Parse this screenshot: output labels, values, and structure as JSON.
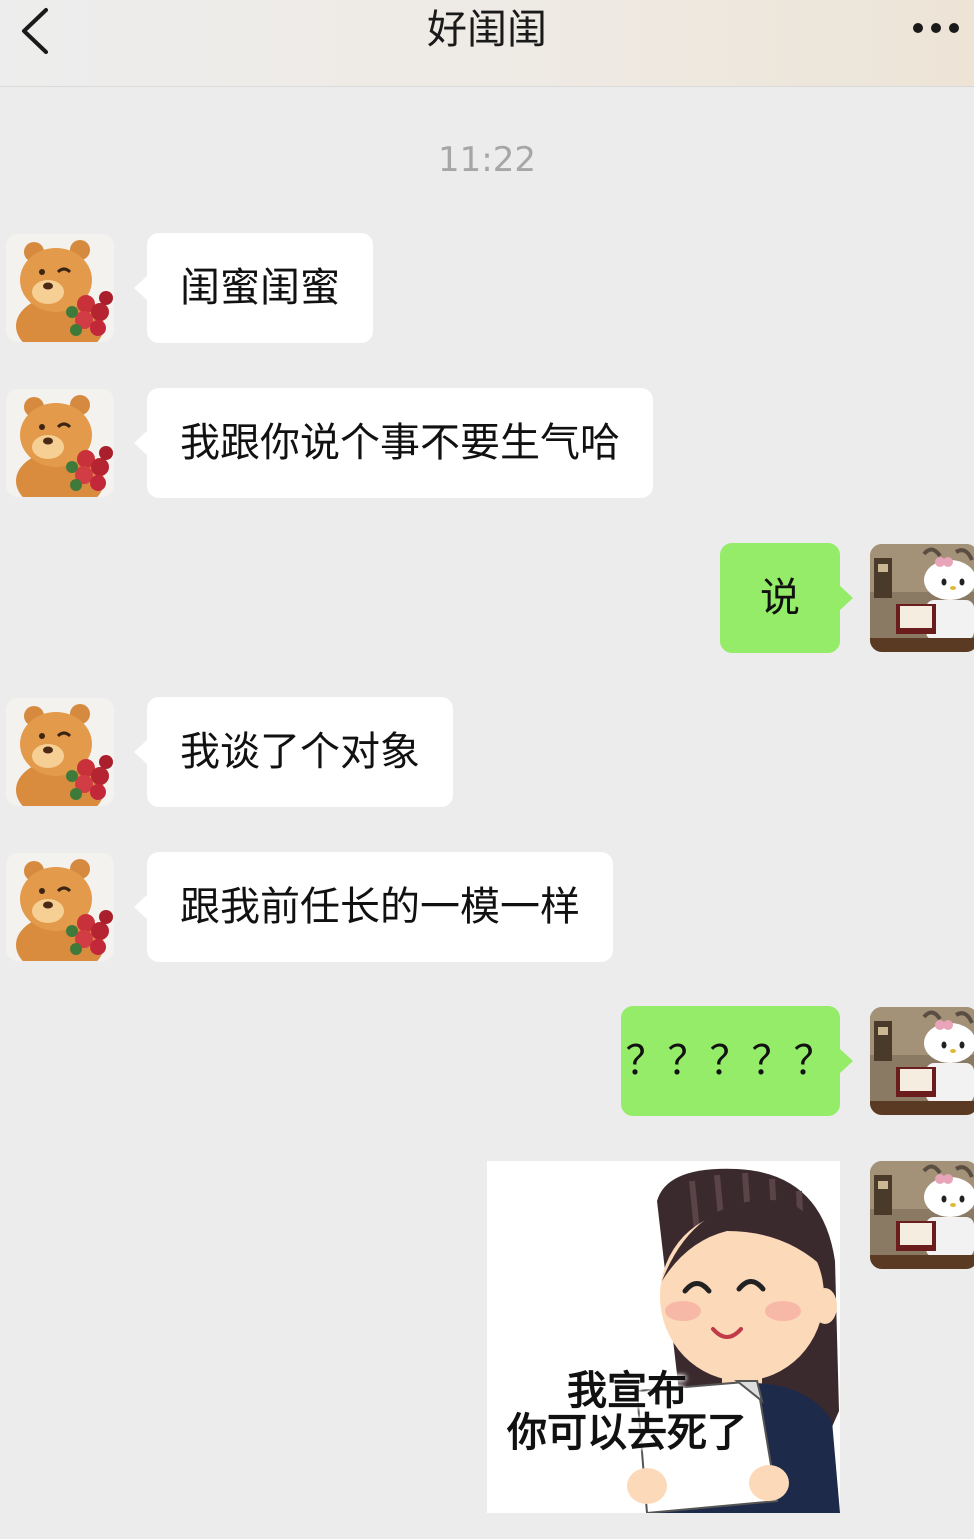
{
  "header": {
    "title": "好闺闺",
    "back_icon": "chevron-left-icon",
    "more_icon": "more-dots-icon"
  },
  "timestamp": "11:22",
  "messages": [
    {
      "side": "in",
      "type": "text",
      "text": "闺蜜闺蜜"
    },
    {
      "side": "in",
      "type": "text",
      "text": "我跟你说个事不要生气哈"
    },
    {
      "side": "out",
      "type": "text",
      "text": "说"
    },
    {
      "side": "in",
      "type": "text",
      "text": "我谈了个对象"
    },
    {
      "side": "in",
      "type": "text",
      "text": "跟我前任长的一模一样"
    },
    {
      "side": "out",
      "type": "text",
      "text": "？？？？？"
    },
    {
      "side": "out",
      "type": "sticker",
      "caption_line1": "我宣布",
      "caption_line2": "你可以去死了"
    }
  ],
  "colors": {
    "background": "#ececec",
    "incoming_bubble": "#ffffff",
    "outgoing_bubble": "#95ec69",
    "timestamp_text": "#a6a6a6"
  },
  "avatars": {
    "contact": "bear-with-roses-avatar",
    "self": "hello-kitty-reading-avatar"
  }
}
